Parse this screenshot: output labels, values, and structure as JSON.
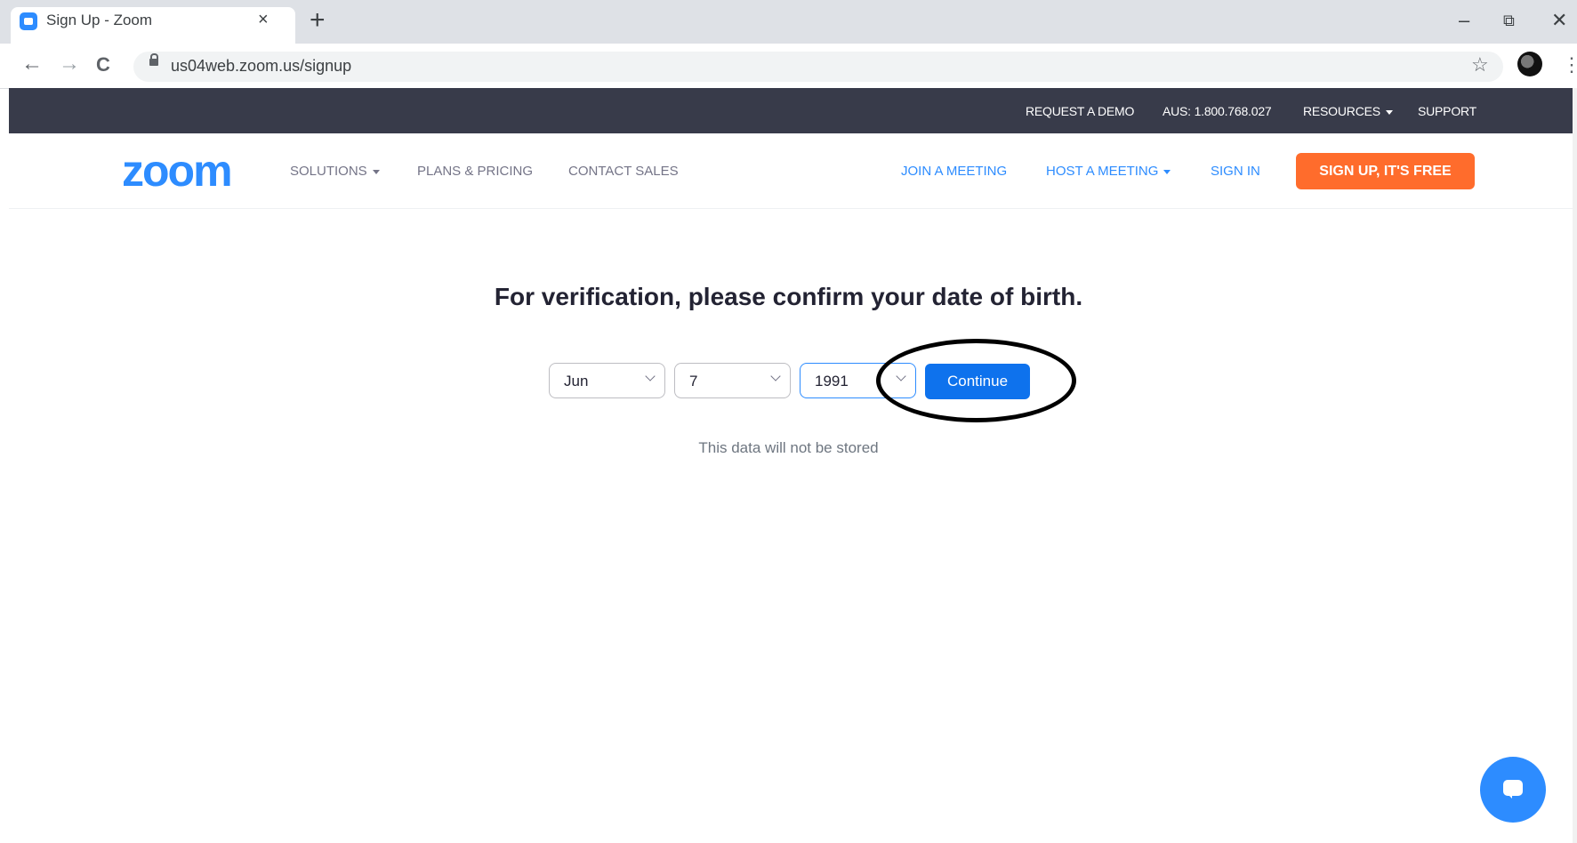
{
  "browser": {
    "tab_title": "Sign Up - Zoom",
    "tab_close": "×",
    "new_tab": "+",
    "minimize": "–",
    "restore": "⧉",
    "close": "✕",
    "back": "←",
    "forward": "→",
    "reload": "C",
    "url": "us04web.zoom.us/signup",
    "star": "☆",
    "menu": "⋮"
  },
  "topbar": {
    "request_demo": "REQUEST A DEMO",
    "phone": "AUS: 1.800.768.027",
    "resources": "RESOURCES",
    "support": "SUPPORT"
  },
  "nav": {
    "logo": "zoom",
    "solutions": "SOLUTIONS",
    "plans": "PLANS & PRICING",
    "contact": "CONTACT SALES",
    "join": "JOIN A MEETING",
    "host": "HOST A MEETING",
    "signin": "SIGN IN",
    "signup": "SIGN UP, IT'S FREE"
  },
  "form": {
    "heading": "For verification, please confirm your date of birth.",
    "month": "Jun",
    "day": "7",
    "year": "1991",
    "continue": "Continue",
    "note": "This data will not be stored"
  },
  "colors": {
    "brand_blue": "#2d8cff",
    "button_blue": "#0e72ed",
    "signup_orange": "#ff6c2c",
    "topbar_dark": "#383b4a"
  }
}
